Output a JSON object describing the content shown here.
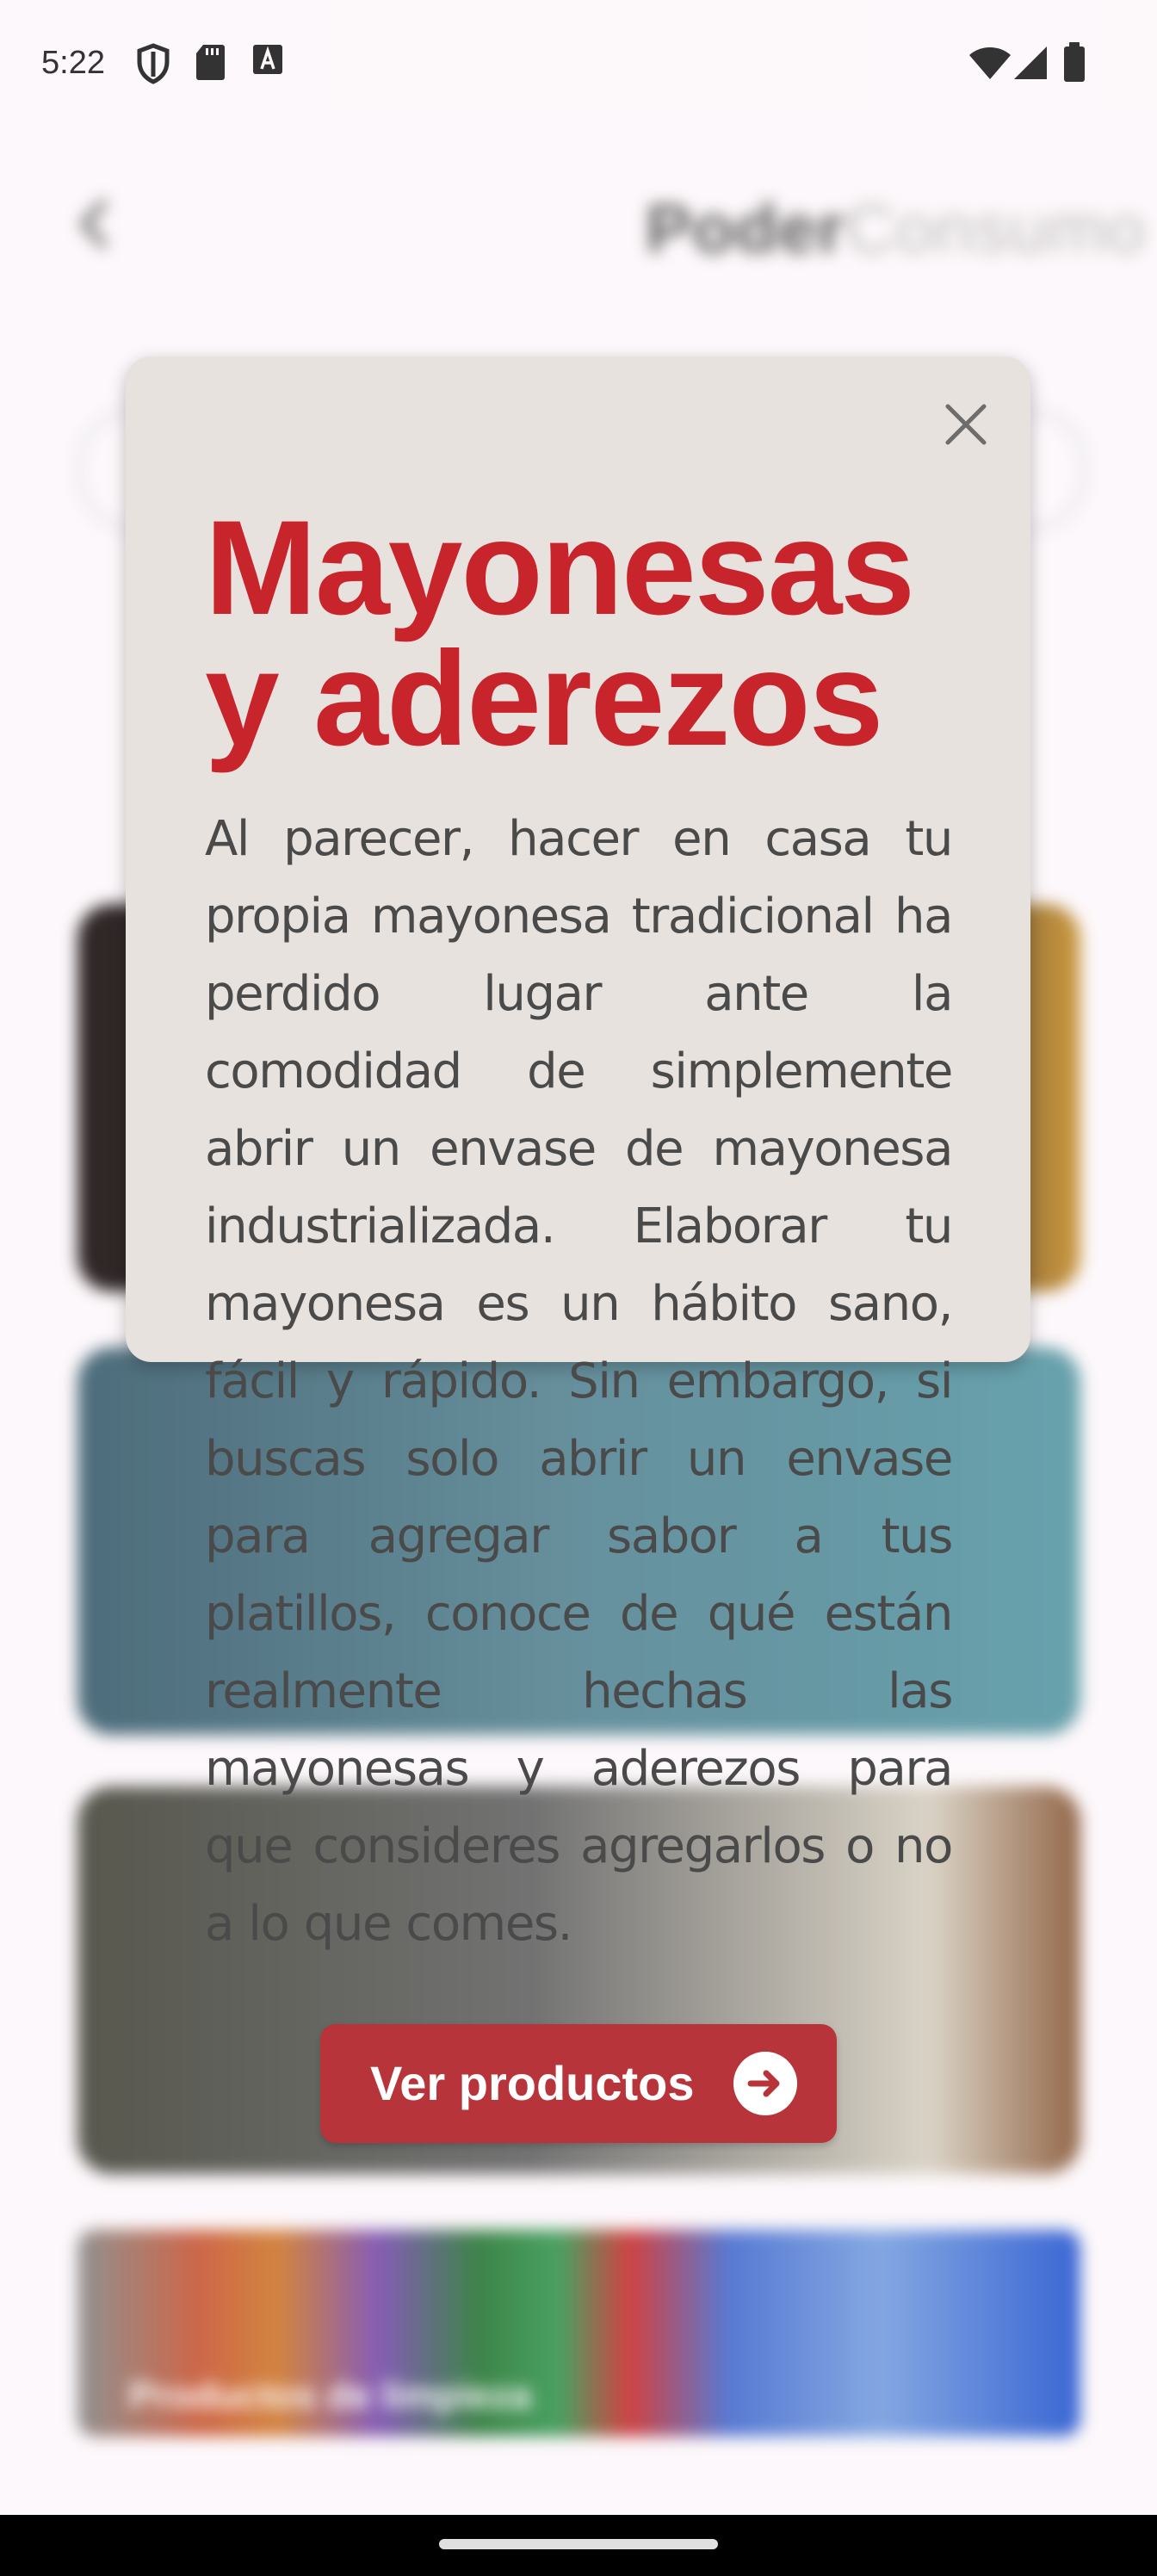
{
  "status_bar": {
    "time": "5:22",
    "left_icons": [
      "shield-icon",
      "sd-card-icon",
      "keyboard-a-icon"
    ],
    "right_icons": [
      "wifi-icon",
      "cell-signal-icon",
      "battery-icon"
    ]
  },
  "background_app": {
    "brand_part1": "Poder",
    "brand_part2": "Consumo",
    "cards_text": [
      "Productos de limpieza"
    ]
  },
  "dialog": {
    "title": "Mayonesas y aderezos",
    "body": "Al parecer, hacer en casa tu propia mayonesa tradicional ha perdido lugar ante la comodidad de simplemente abrir un envase de mayonesa industrializada. Elaborar tu mayonesa es un hábito sano, fácil y rápido. Sin embargo, si buscas solo abrir un envase para agregar sabor a tus platillos, conoce de qué están realmente hechas las mayonesas y aderezos para que consideres agregarlos o no a lo que comes.",
    "cta_label": "Ver productos",
    "cta_icon": "arrow-right-circle-icon",
    "close_icon": "close-icon"
  },
  "colors": {
    "accent": "#c8242c",
    "button": "#b8343b",
    "dialog_bg": "#e7e2de",
    "body_text": "#4a4a4a"
  }
}
